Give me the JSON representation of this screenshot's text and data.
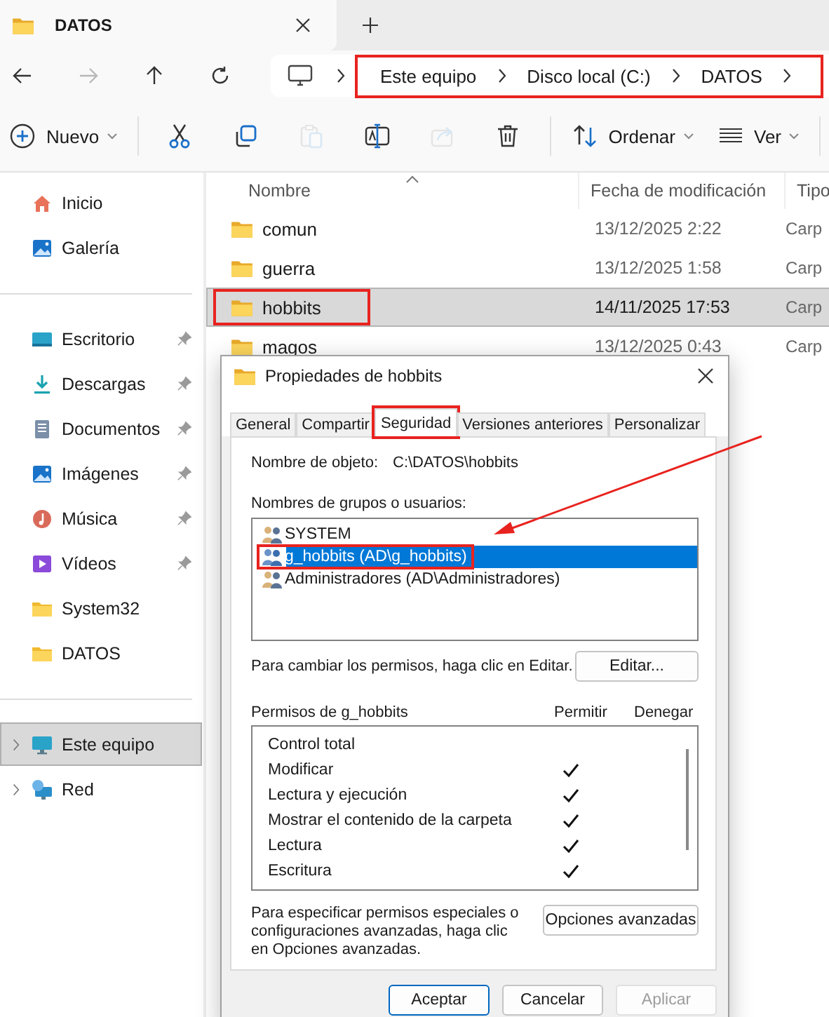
{
  "explorer_tab": {
    "title": "DATOS"
  },
  "address": {
    "highlighted": true,
    "crumbs": [
      "Este equipo",
      "Disco local (C:)",
      "DATOS"
    ]
  },
  "toolbar": [
    {
      "kind": "new",
      "label": "Nuevo",
      "disabled": false
    },
    {
      "kind": "cut",
      "disabled": false
    },
    {
      "kind": "copy",
      "disabled": false
    },
    {
      "kind": "paste",
      "disabled": true
    },
    {
      "kind": "rename",
      "disabled": false
    },
    {
      "kind": "share",
      "disabled": true
    },
    {
      "kind": "delete",
      "disabled": false
    },
    {
      "kind": "sort",
      "label": "Ordenar",
      "disabled": false
    },
    {
      "kind": "view",
      "label": "Ver",
      "disabled": false
    }
  ],
  "sidebar": {
    "groups": [
      [
        {
          "kind": "home",
          "label": "Inicio",
          "pinned": false,
          "selected": false
        },
        {
          "kind": "gallery",
          "label": "Galería",
          "pinned": false,
          "selected": false
        }
      ],
      [
        {
          "kind": "desktop",
          "label": "Escritorio",
          "pinned": true,
          "selected": false
        },
        {
          "kind": "download",
          "label": "Descargas",
          "pinned": true,
          "selected": false
        },
        {
          "kind": "documents",
          "label": "Documentos",
          "pinned": true,
          "selected": false
        },
        {
          "kind": "images",
          "label": "Imágenes",
          "pinned": true,
          "selected": false
        },
        {
          "kind": "music",
          "label": "Música",
          "pinned": true,
          "selected": false
        },
        {
          "kind": "videos",
          "label": "Vídeos",
          "pinned": true,
          "selected": false
        },
        {
          "kind": "folder",
          "label": "System32",
          "pinned": false,
          "selected": false
        },
        {
          "kind": "folder",
          "label": "DATOS",
          "pinned": false,
          "selected": false
        }
      ],
      [
        {
          "kind": "computer",
          "label": "Este equipo",
          "pinned": false,
          "selected": true,
          "expanded": false
        },
        {
          "kind": "network",
          "label": "Red",
          "pinned": false,
          "selected": false,
          "expanded": false
        }
      ]
    ]
  },
  "files": {
    "columns": [
      "Nombre",
      "Fecha de modificación",
      "Tipo"
    ],
    "rows": [
      {
        "name": "comun",
        "date": "13/12/2025 2:22",
        "type": "Carp",
        "selected": false,
        "highlighted": false
      },
      {
        "name": "guerra",
        "date": "13/12/2025 1:58",
        "type": "Carp",
        "selected": false,
        "highlighted": false
      },
      {
        "name": "hobbits",
        "date": "14/11/2025 17:53",
        "type": "Carp",
        "selected": true,
        "highlighted": true
      },
      {
        "name": "magos",
        "date": "13/12/2025 0:43",
        "type": "Carp",
        "selected": false,
        "highlighted": false
      }
    ]
  },
  "dialog": {
    "title": "Propiedades de hobbits",
    "tabs": [
      {
        "label": "General",
        "selected": false,
        "highlighted": false
      },
      {
        "label": "Compartir",
        "selected": false,
        "highlighted": false
      },
      {
        "label": "Seguridad",
        "selected": true,
        "highlighted": true
      },
      {
        "label": "Versiones anteriores",
        "selected": false,
        "highlighted": false
      },
      {
        "label": "Personalizar",
        "selected": false,
        "highlighted": false
      }
    ],
    "object_label": "Nombre de objeto:",
    "object_value": "C:\\DATOS\\hobbits",
    "users_label": "Nombres de grupos o usuarios:",
    "users": [
      {
        "name": "SYSTEM",
        "selected": false,
        "highlighted": false
      },
      {
        "name": "g_hobbits (AD\\g_hobbits)",
        "selected": true,
        "highlighted": true
      },
      {
        "name": "Administradores (AD\\Administradores)",
        "selected": false,
        "highlighted": false
      }
    ],
    "edit_hint": "Para cambiar los permisos, haga clic en Editar.",
    "edit_button": "Editar...",
    "permissions_label": "Permisos de g_hobbits",
    "allow_label": "Permitir",
    "deny_label": "Denegar",
    "permissions": [
      {
        "name": "Control total",
        "allow": false,
        "deny": false
      },
      {
        "name": "Modificar",
        "allow": true,
        "deny": false
      },
      {
        "name": "Lectura y ejecución",
        "allow": true,
        "deny": false
      },
      {
        "name": "Mostrar el contenido de la carpeta",
        "allow": true,
        "deny": false
      },
      {
        "name": "Lectura",
        "allow": true,
        "deny": false
      },
      {
        "name": "Escritura",
        "allow": true,
        "deny": false
      }
    ],
    "advanced_hint": "Para especificar permisos especiales o configuraciones avanzadas, haga clic en Opciones avanzadas.",
    "advanced_button": "Opciones avanzadas",
    "buttons": [
      {
        "label": "Aceptar",
        "kind": "default",
        "disabled": false
      },
      {
        "label": "Cancelar",
        "kind": "normal",
        "disabled": false
      },
      {
        "label": "Aplicar",
        "kind": "normal",
        "disabled": true
      }
    ]
  }
}
